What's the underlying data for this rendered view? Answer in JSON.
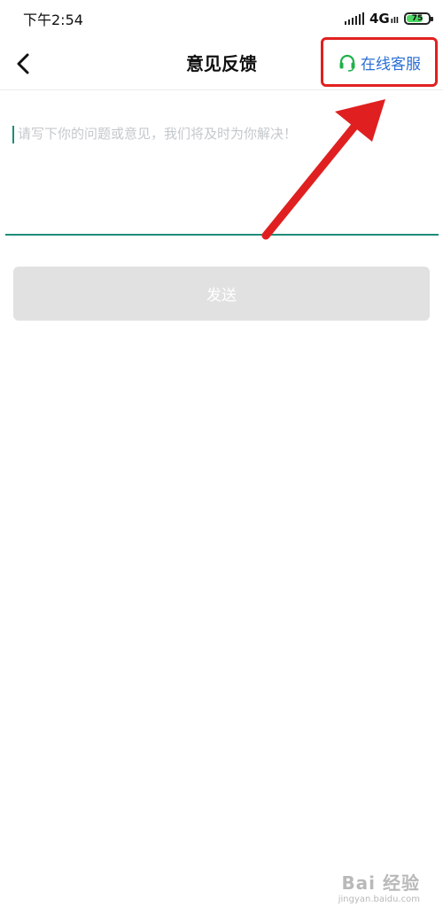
{
  "status_bar": {
    "time": "下午2:54",
    "network": "4G",
    "network_sub": "ıll",
    "battery": "75",
    "battery_level": 0.75
  },
  "nav": {
    "title": "意见反馈",
    "back_icon": "chevron-left-icon",
    "service_icon": "headset-icon",
    "service_label": "在线客服"
  },
  "feedback": {
    "placeholder": "请写下你的问题或意见，我们将及时为你解决！",
    "value": ""
  },
  "send_button": {
    "label": "发送"
  },
  "watermark": {
    "line1": "Bai 经验",
    "line2": "jingyan.baidu.com"
  },
  "colors": {
    "accent": "#1e8c78",
    "link": "#2a6fd6",
    "headset": "#21b14b",
    "annotation": "#e02020",
    "button_disabled": "#e1e1e1"
  }
}
